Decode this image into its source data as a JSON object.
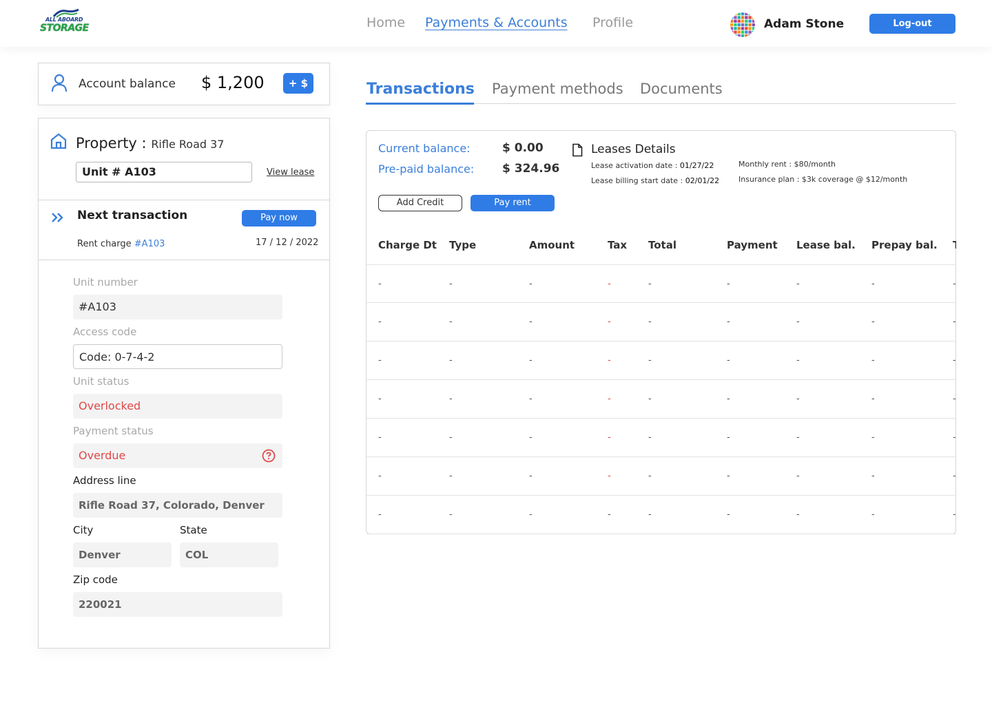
{
  "header": {
    "logo": {
      "top": "ALL ABOARD",
      "bottom": "STORAGE"
    },
    "nav": [
      {
        "label": "Home",
        "active": false
      },
      {
        "label": "Payments & Accounts",
        "active": true
      },
      {
        "label": "Profile",
        "active": false
      }
    ],
    "user_name": "Adam Stone",
    "logout_label": "Log-out"
  },
  "account": {
    "label": "Account balance",
    "amount": "$ 1,200",
    "add_label": "+ $"
  },
  "property": {
    "title_label": "Property :",
    "title_value": "Rifle Road 37",
    "unit": "Unit # A103",
    "view_lease": "View lease"
  },
  "next_transaction": {
    "title": "Next transaction",
    "pay_now": "Pay now",
    "charge_label": "Rent charge",
    "charge_unit": "#A103",
    "date": "17 / 12 / 2022"
  },
  "details": {
    "unit_number_label": "Unit number",
    "unit_number": "#A103",
    "access_code_label": "Access code",
    "access_code": "Code: 0-7-4-2",
    "unit_status_label": "Unit status",
    "unit_status": "Overlocked",
    "payment_status_label": "Payment status",
    "payment_status": "Overdue",
    "address_label": "Address line",
    "address": "Rifle Road 37, Colorado, Denver",
    "city_label": "City",
    "city": "Denver",
    "state_label": "State",
    "state": "COL",
    "zip_label": "Zip code",
    "zip": "220021"
  },
  "tabs": [
    {
      "label": "Transactions",
      "active": true
    },
    {
      "label": "Payment methods",
      "active": false
    },
    {
      "label": "Documents",
      "active": false
    }
  ],
  "balances": {
    "current_label": "Current balance:",
    "current_value": "$ 0.00",
    "prepaid_label": "Pre-paid balance:",
    "prepaid_value": "$ 324.96",
    "add_credit": "Add Credit",
    "pay_rent": "Pay rent"
  },
  "lease": {
    "title": "Leases Details",
    "activation_label": "Lease activation date :",
    "activation_value": "01/27/22",
    "billing_label": "Lease billing start date :",
    "billing_value": "02/01/22",
    "monthly_rent": "Monthly rent : $80/month",
    "insurance": "Insurance plan : $3k coverage @ $12/month"
  },
  "table": {
    "columns": [
      "Charge Dt",
      "Type",
      "Amount",
      "Tax",
      "Total",
      "Payment",
      "Lease bal.",
      "Prepay bal.",
      "T"
    ],
    "rows": [
      [
        "-",
        "-",
        "-",
        "-",
        "-",
        "-",
        "-",
        "-",
        "-"
      ],
      [
        "-",
        "-",
        "-",
        "-",
        "-",
        "-",
        "-",
        "-",
        "-"
      ],
      [
        "-",
        "-",
        "-",
        "-",
        "-",
        "-",
        "-",
        "-",
        "-"
      ],
      [
        "-",
        "-",
        "-",
        "-",
        "-",
        "-",
        "-",
        "-",
        "-"
      ],
      [
        "-",
        "-",
        "-",
        "-",
        "-",
        "-",
        "-",
        "-",
        "-"
      ],
      [
        "-",
        "-",
        "-",
        "-",
        "-",
        "-",
        "-",
        "-",
        "-"
      ],
      [
        "-",
        "-",
        "-",
        "-",
        "-",
        "-",
        "-",
        "-",
        "-"
      ]
    ],
    "tax_red_rows": [
      true,
      true,
      true,
      true,
      true,
      true,
      false
    ]
  },
  "colors": {
    "accent": "#2f7ce6",
    "link": "#3b7fd9",
    "danger": "#e04848"
  }
}
